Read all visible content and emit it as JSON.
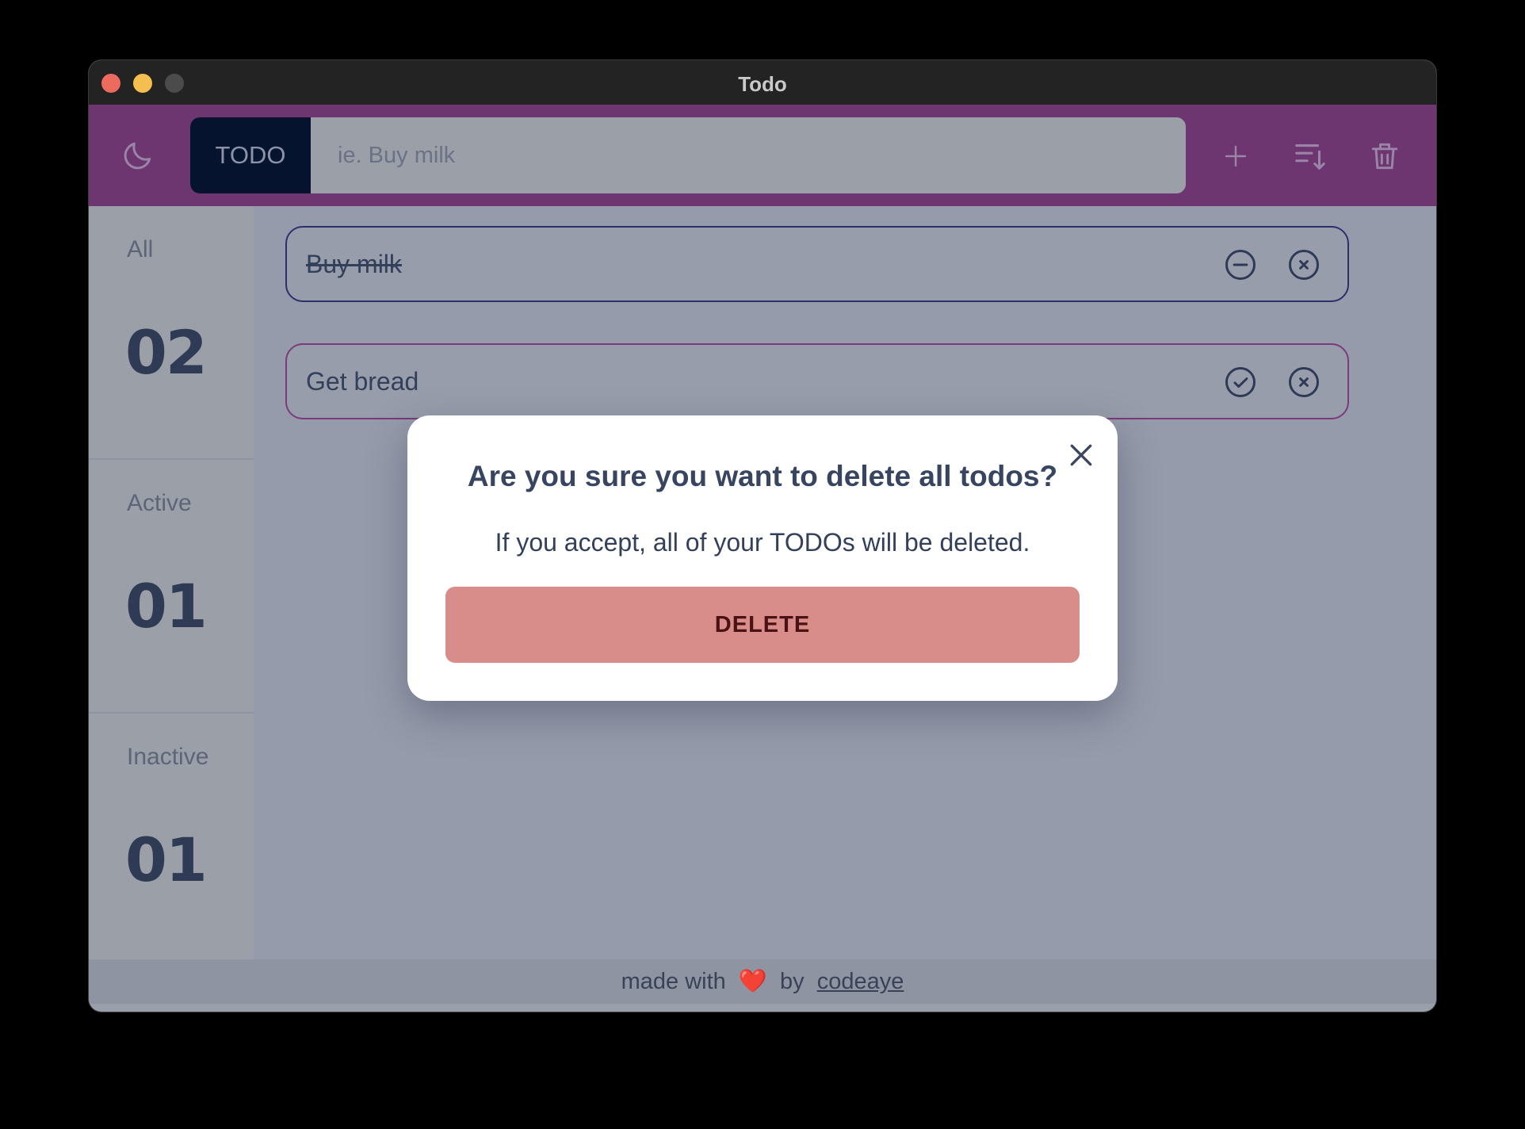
{
  "window": {
    "title": "Todo"
  },
  "header": {
    "tag": "TODO",
    "input_placeholder": "ie. Buy milk",
    "input_value": "",
    "icons": [
      "moon-icon",
      "plus-icon",
      "sort-icon",
      "trash-icon"
    ]
  },
  "sidebar": {
    "stats": [
      {
        "label": "All",
        "value": "02"
      },
      {
        "label": "Active",
        "value": "01"
      },
      {
        "label": "Inactive",
        "value": "01"
      }
    ]
  },
  "todos": [
    {
      "text": "Buy milk",
      "completed": true,
      "actions": [
        "minus-circle-icon",
        "x-circle-icon"
      ]
    },
    {
      "text": "Get bread",
      "completed": false,
      "actions": [
        "check-circle-icon",
        "x-circle-icon"
      ]
    }
  ],
  "modal": {
    "title": "Are you sure you want to delete all todos?",
    "body": "If you accept, all of your TODOs will be deleted.",
    "delete_label": "DELETE"
  },
  "footer": {
    "made_with": "made with",
    "heart": "❤️",
    "by": "by",
    "author": "codeaye"
  },
  "colors": {
    "header_bg": "#6e3670",
    "tag_bg": "#06132f",
    "delete_button": "#d98d8b",
    "done_border": "#2d2f6b",
    "pending_border": "#7b3a7c"
  }
}
